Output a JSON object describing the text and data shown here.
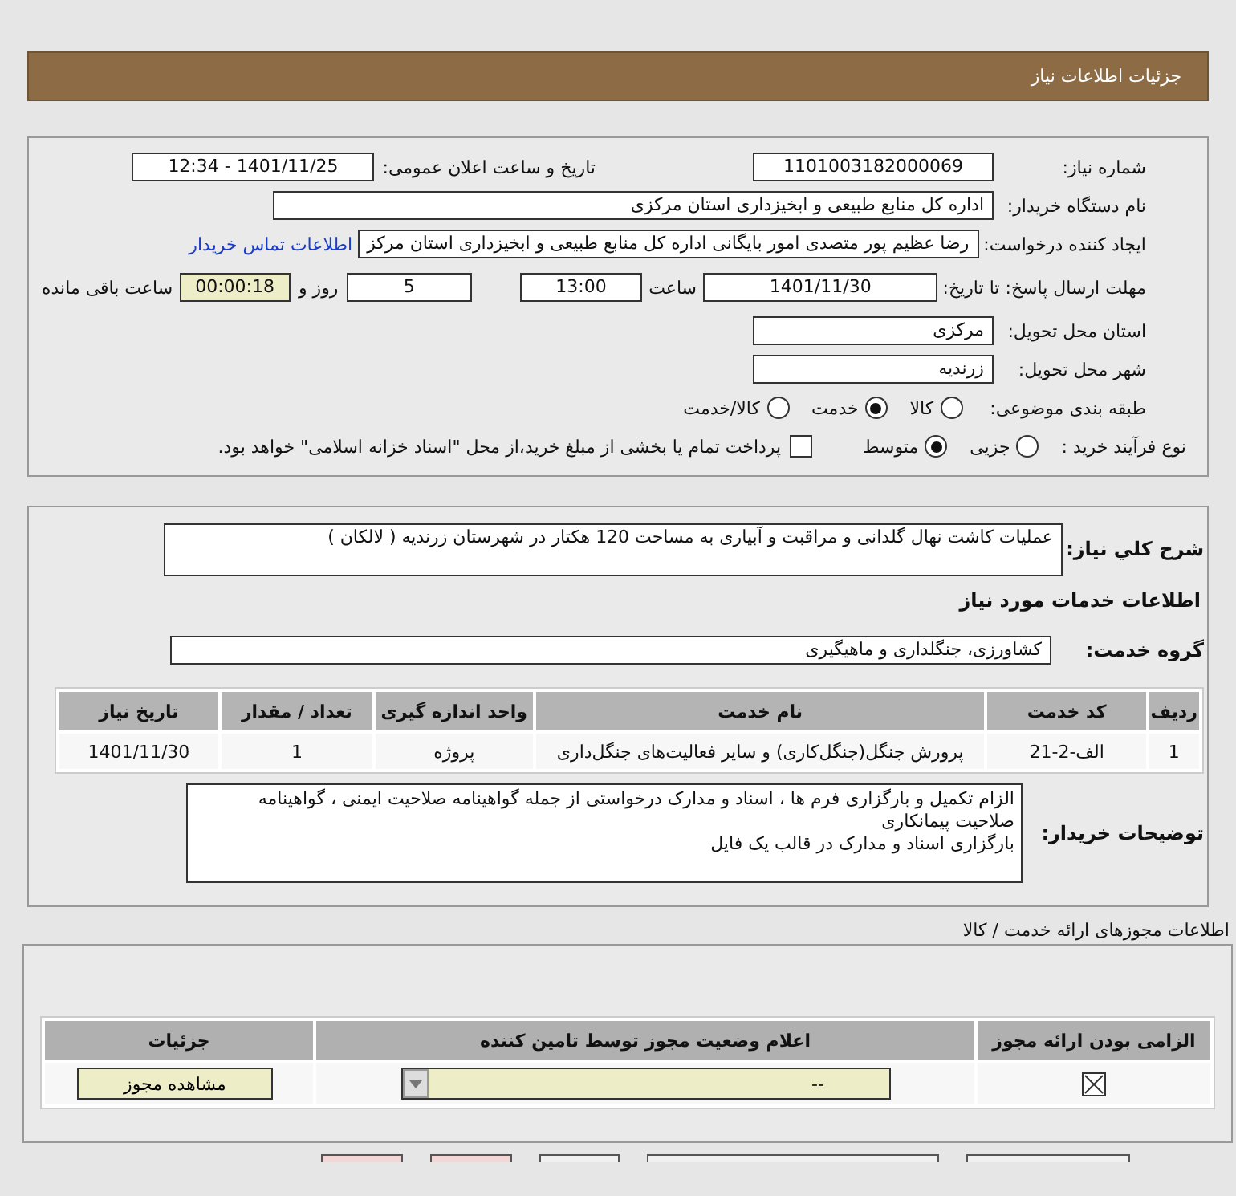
{
  "header": {
    "title": "جزئیات اطلاعات نیاز"
  },
  "need_form": {
    "need_number": {
      "label": "شماره نیاز:",
      "value": "1101003182000069"
    },
    "announce_datetime": {
      "label": "تاریخ و ساعت اعلان عمومی:",
      "value": "1401/11/25 - 12:34"
    },
    "buyer_org": {
      "label": "نام دستگاه خریدار:",
      "value": "اداره کل منابع طبیعی و ابخیزداری استان مرکزی"
    },
    "requester": {
      "label": "ایجاد کننده درخواست:",
      "value": "رضا عظیم پور متصدی امور بایگانی اداره کل منابع طبیعی و ابخیزداری استان مرکز",
      "link": "اطلاعات تماس خریدار"
    },
    "deadline": {
      "label": "مهلت ارسال پاسخ: تا تاریخ:",
      "date": "1401/11/30",
      "time_label": "ساعت",
      "time": "13:00",
      "days": "5",
      "days_label": "روز و",
      "remaining": "00:00:18",
      "remaining_label": "ساعت باقی مانده"
    },
    "province": {
      "label": "استان محل تحویل:",
      "value": "مرکزی"
    },
    "city": {
      "label": "شهر محل تحویل:",
      "value": "زرندیه"
    },
    "category": {
      "label": "طبقه بندی موضوعی:",
      "options": [
        {
          "label": "کالا",
          "selected": false
        },
        {
          "label": "خدمت",
          "selected": true
        },
        {
          "label": "کالا/خدمت",
          "selected": false
        }
      ]
    },
    "purchase_process": {
      "label": "نوع فرآیند خرید :",
      "options": [
        {
          "label": "جزیی",
          "selected": false
        },
        {
          "label": "متوسط",
          "selected": true
        }
      ],
      "payment": {
        "label": "پرداخت تمام یا بخشی از مبلغ خرید،از محل \"اسناد خزانه اسلامی\" خواهد بود.",
        "checked": false
      }
    }
  },
  "details": {
    "summary": {
      "label": "شرح کلي نياز:",
      "value": "عملیات کاشت نهال گلدانی و مراقبت و آبیاری به مساحت 120 هکتار در شهرستان زرندیه ( لالکان )"
    },
    "services_heading": "اطلاعات خدمات مورد نیاز",
    "service_group": {
      "label": "گروه خدمت:",
      "value": "کشاورزی، جنگلداری و ماهیگیری"
    },
    "table": {
      "columns": [
        "ردیف",
        "کد خدمت",
        "نام خدمت",
        "واحد اندازه گیری",
        "تعداد / مقدار",
        "تاریخ نیاز"
      ],
      "rows": [
        [
          "1",
          "الف-2-21",
          "پرورش جنگل(جنگل‌کاری) و سایر فعالیت‌های جنگل‌داری",
          "پروژه",
          "1",
          "1401/11/30"
        ]
      ]
    },
    "buyer_notes": {
      "label": "توضیحات خریدار:",
      "lines": [
        "الزام تکمیل و بارگزاری فرم ها ، اسناد و مدارک درخواستی از جمله گواهینامه صلاحیت ایمنی ، گواهینامه صلاحیت پیمانکاری",
        "بارگزاری اسناد و مدارک در قالب یک فایل"
      ]
    }
  },
  "permits": {
    "title": "اطلاعات مجوزهای ارائه خدمت / کالا",
    "columns": [
      "الزامی بودن ارائه مجوز",
      "اعلام وضعیت مجوز توسط تامین کننده",
      "جزئیات"
    ],
    "rows": [
      {
        "required": true,
        "status": "--",
        "button": "مشاهده مجوز"
      }
    ]
  },
  "footer_buttons": [
    {
      "kind": "plain"
    },
    {
      "kind": "wide"
    },
    {
      "kind": "small"
    },
    {
      "kind": "alert"
    },
    {
      "kind": "alert"
    }
  ]
}
